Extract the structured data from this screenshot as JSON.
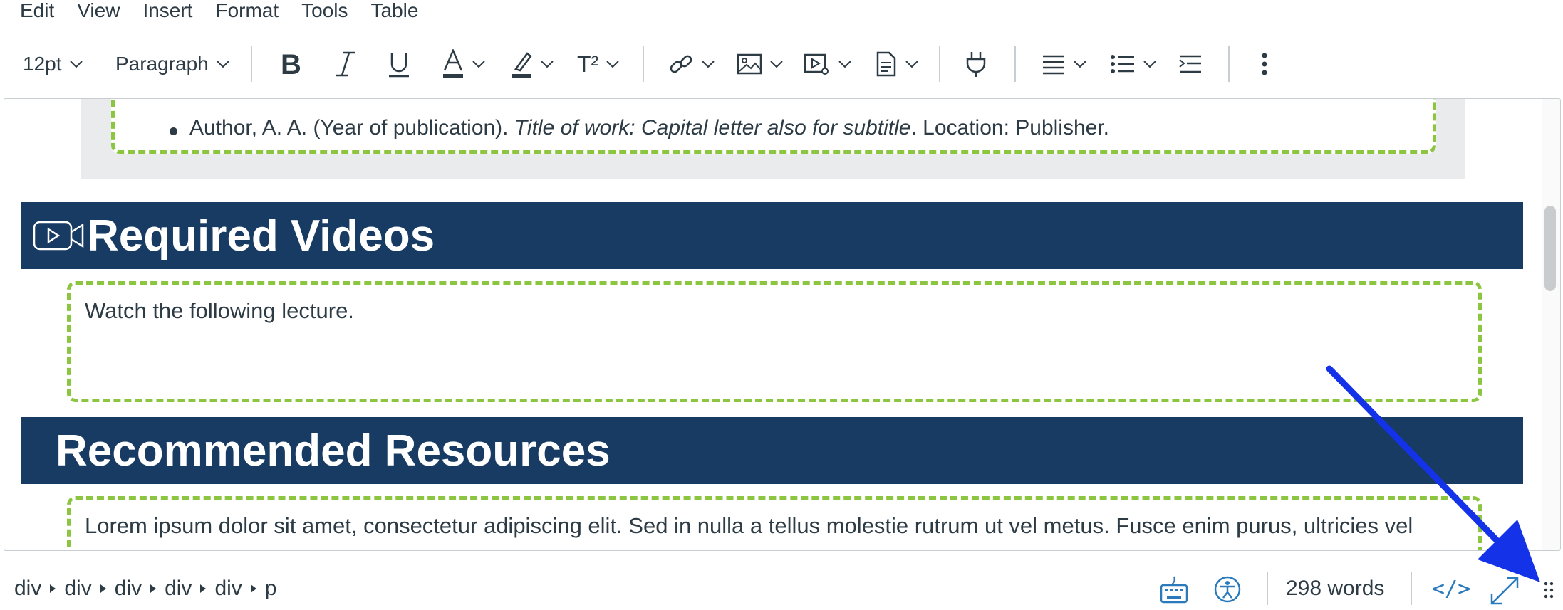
{
  "menubar": {
    "items": [
      "Edit",
      "View",
      "Insert",
      "Format",
      "Tools",
      "Table"
    ]
  },
  "toolbar": {
    "font_size": "12pt",
    "block_format": "Paragraph",
    "icons": [
      "bold-icon",
      "italic-icon",
      "underline-icon",
      "text-color-icon",
      "highlight-icon",
      "superscript-icon",
      "link-icon",
      "image-icon",
      "media-icon",
      "document-icon",
      "plugin-icon",
      "align-icon",
      "bullet-list-icon",
      "indent-icon",
      "more-icon"
    ],
    "superscript_label": "T²"
  },
  "content": {
    "citation_prefix": "Author, A. A. (Year of publication). ",
    "citation_title": "Title of work: Capital letter also for subtitle",
    "citation_suffix": ". Location: Publisher.",
    "heading_videos": "Required Videos",
    "videos_text": "Watch the following lecture.",
    "heading_resources": "Recommended Resources",
    "resources_text": "Lorem ipsum dolor sit amet, consectetur adipiscing elit. Sed in nulla a tellus molestie rutrum ut vel metus. Fusce enim purus, ultricies vel"
  },
  "statusbar": {
    "path": [
      "div",
      "div",
      "div",
      "div",
      "div",
      "p"
    ],
    "word_count": "298 words",
    "html_toggle": "</>"
  },
  "colors": {
    "band": "#183b63",
    "dashed_border": "#8cc540",
    "annotation_arrow": "#1432e8",
    "link_blue": "#2b7abc"
  }
}
